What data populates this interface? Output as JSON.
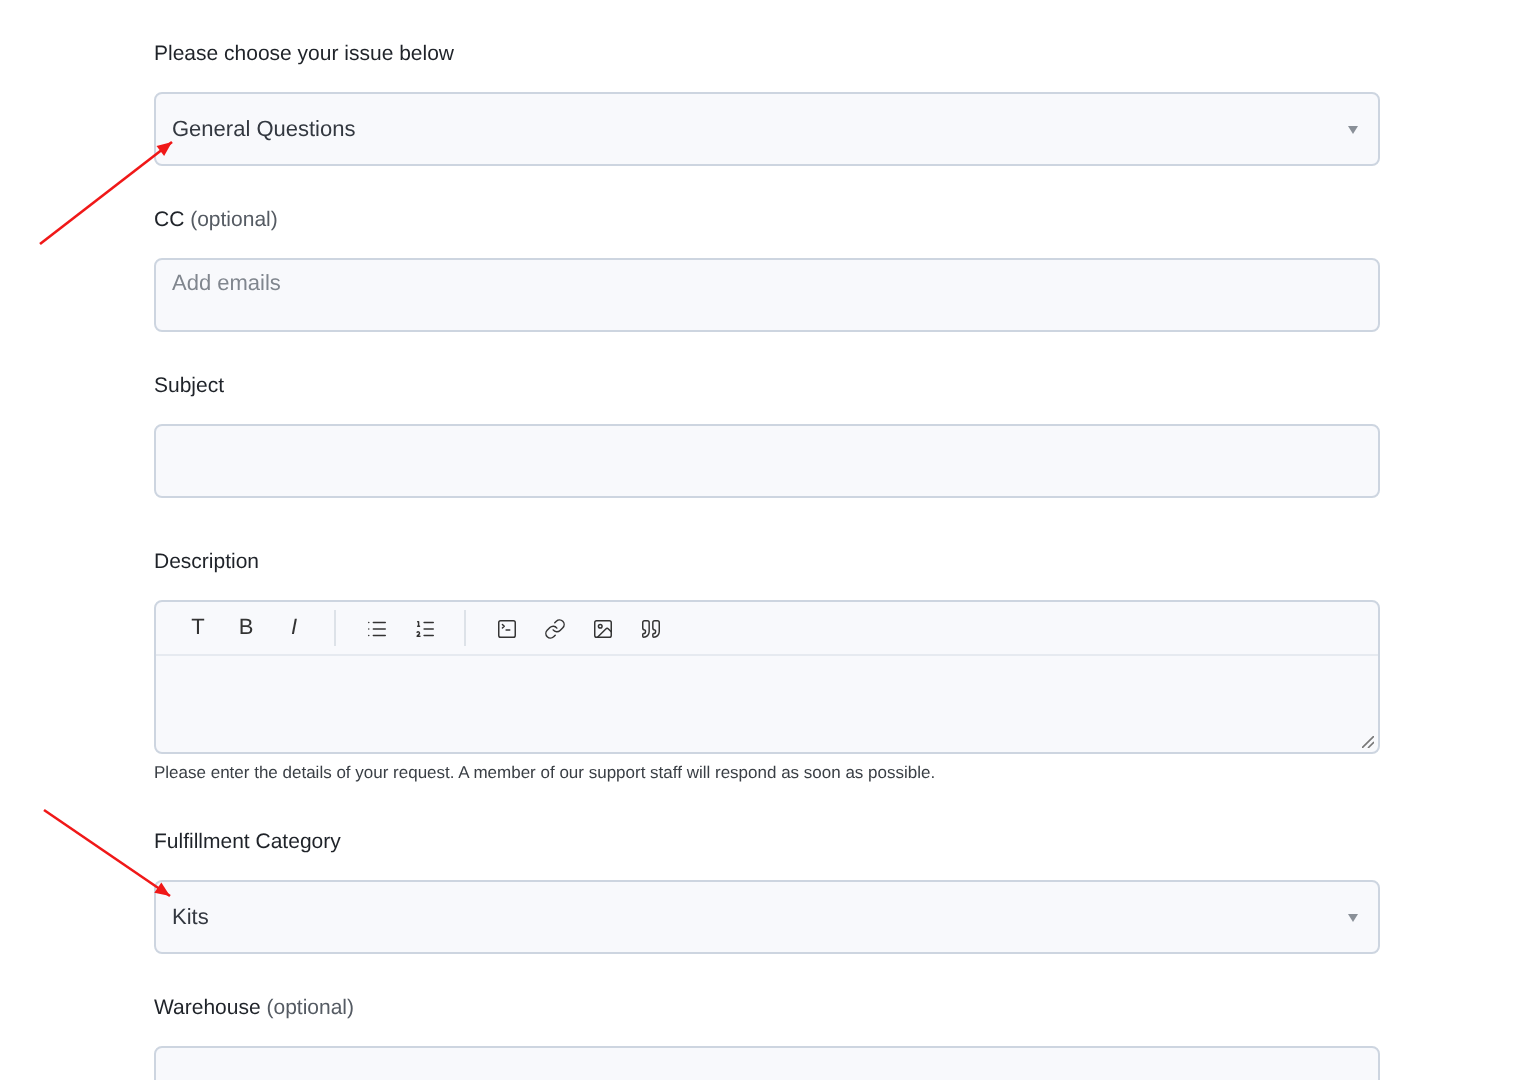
{
  "fields": [
    {
      "kind": "select",
      "label": "Please choose your issue below",
      "value": "General Questions",
      "annotated": true
    },
    {
      "kind": "input",
      "label": "CC",
      "hint": "(optional)",
      "placeholder": "Add emails"
    },
    {
      "kind": "input",
      "label": "Subject"
    },
    {
      "kind": "editor",
      "label": "Description",
      "format_buttons": [
        "T",
        "B",
        "I"
      ],
      "help": "Please enter the details of your request. A member of our support staff will respond as soon as possible."
    },
    {
      "kind": "select",
      "label": "Fulfillment Category",
      "value": "Kits",
      "annotated": true
    },
    {
      "kind": "select",
      "label": "Warehouse",
      "hint": "(optional)"
    }
  ]
}
